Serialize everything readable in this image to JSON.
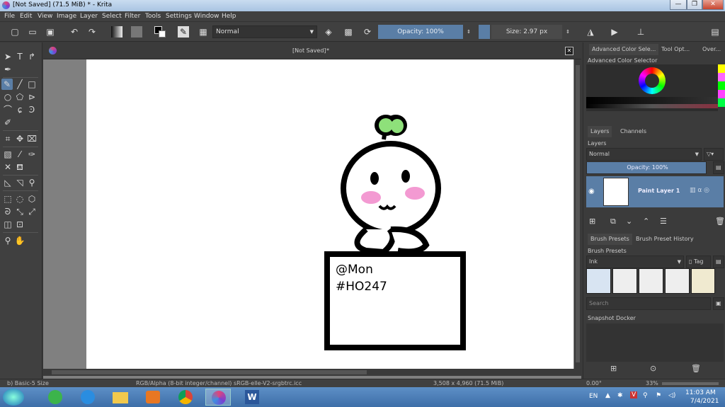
{
  "window": {
    "title": "[Not Saved]  (71.5 MiB)  * - Krita",
    "minimize": "—",
    "restore": "❐",
    "close": "✕"
  },
  "menu": [
    "File",
    "Edit",
    "View",
    "Image",
    "Layer",
    "Select",
    "Filter",
    "Tools",
    "Settings",
    "Window",
    "Help"
  ],
  "toolbar": {
    "blend_mode": "Normal",
    "opacity": "Opacity: 100%",
    "size": "Size: 2.97 px"
  },
  "document": {
    "tab_title": "[Not Saved]",
    "tab_marker": "*",
    "note_line1": "@Mon",
    "note_line2": "#HO247"
  },
  "docker": {
    "tabs": [
      "Advanced Color Sele...",
      "Tool Opt...",
      "Over..."
    ],
    "color_selector_title": "Advanced Color Selector",
    "layer_tabs": [
      "Layers",
      "Channels"
    ],
    "layers_title": "Layers",
    "layer_blend": "Normal",
    "layer_opacity": "Opacity:  100%",
    "layer_name": "Paint Layer 1",
    "brush_tabs": [
      "Brush Presets",
      "Brush Preset History"
    ],
    "brush_presets_title": "Brush Presets",
    "brush_filter": "Ink",
    "tag_label": "Tag",
    "search_placeholder": "Search",
    "snapshot_title": "Snapshot Docker"
  },
  "status": {
    "brush": "b) Basic-5 Size",
    "color_space": "RGB/Alpha (8-bit integer/channel)  sRGB-elle-V2-srgbtrc.icc",
    "doc_size": "3,508 x 4,960 (71.5 MiB)",
    "rotation": "0.00°",
    "zoom": "33%"
  },
  "taskbar": {
    "language": "EN",
    "time": "11:03 AM",
    "date": "7/4/2021"
  },
  "colors": {
    "accent": "#5a7ea6",
    "sprout": "#8ee07a",
    "blush": "#f39ad2"
  }
}
